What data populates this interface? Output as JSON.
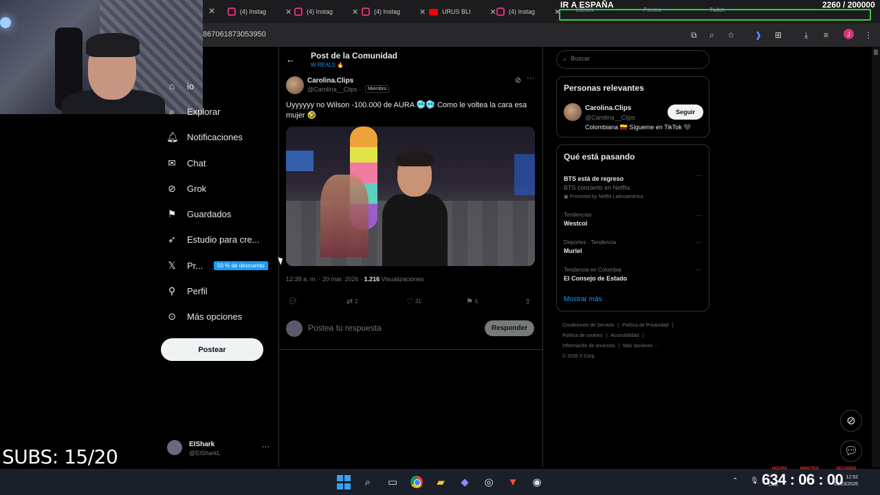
{
  "stream_overlay": {
    "goal_title": "IR A ESPAÑA",
    "goal_count": "2260 / 200000",
    "subs": "SUBS: 15/20",
    "timer": "634 : 06 : 00",
    "timer_labels": [
      "HOURS",
      "MINUTES",
      "SECONDS"
    ]
  },
  "browser": {
    "tabs": [
      {
        "label": "(4) Instag",
        "icon": "instagram-icon"
      },
      {
        "label": "(4) Instag",
        "icon": "instagram-icon"
      },
      {
        "label": "(4) Instag",
        "icon": "instagram-icon"
      },
      {
        "label": "URUS BLI",
        "icon": "youtube-icon"
      },
      {
        "label": "(4) Instag",
        "icon": "instagram-icon"
      }
    ],
    "group_tabs": [
      "ElDomi -",
      "Pereira",
      "Twitch"
    ],
    "url": "867061873053950",
    "profile_initial": "J"
  },
  "nav": {
    "items": [
      {
        "label": "io",
        "icon": "home-icon"
      },
      {
        "label": "Explorar",
        "icon": "search-icon"
      },
      {
        "label": "Notificaciones",
        "icon": "bell-icon"
      },
      {
        "label": "Chat",
        "icon": "mail-icon"
      },
      {
        "label": "Grok",
        "icon": "grok-icon"
      },
      {
        "label": "Guardados",
        "icon": "bookmark-icon"
      },
      {
        "label": "Estudio para cre...",
        "icon": "rocket-icon"
      },
      {
        "label": "Pr...",
        "icon": "x-logo-icon"
      },
      {
        "label": "Perfil",
        "icon": "person-icon"
      },
      {
        "label": "Más opciones",
        "icon": "more-circle-icon"
      }
    ],
    "premium_badge": "50 % de descuento",
    "post_button": "Postear",
    "account": {
      "name": "ElShark",
      "handle": "@ElSharkL"
    }
  },
  "post": {
    "header_title": "Post de la Comunidad",
    "header_sub": "W REALS 🔥",
    "author_name": "Carolina.Clips",
    "author_handle": "@Carolina__Clips ·",
    "member_badge": "Miembro",
    "text": "Uyyyyyy no Wilson -100.000 de AURA 🥶🥶 Como le voltea la cara esa mujer 🤣",
    "timestamp": "12:38 a. m. · 20 mar. 2026 ·",
    "views_count": "1.216",
    "views_label": "Visualizaciones",
    "actions": {
      "replies": "",
      "reposts": "2",
      "likes": "31",
      "bookmarks": "5"
    },
    "reply_placeholder": "Postea tu respuesta",
    "reply_button": "Responder"
  },
  "sidebar": {
    "search_placeholder": "Buscar",
    "relevant_title": "Personas relevantes",
    "relevant_person": {
      "name": "Carolina.Clips",
      "handle": "@Carolina__Clips",
      "bio": "Colombiana 🇨🇴 Sígueme en TikTok 🖤",
      "follow": "Seguir"
    },
    "trending_title": "Qué está pasando",
    "trends": [
      {
        "context": "",
        "title": "BTS está de regreso",
        "sub": "BTS concierto en Netflix",
        "promo": "Promoted by Netflix Latinoamérica"
      },
      {
        "context": "Tendencias",
        "title": "Westcol",
        "sub": "",
        "promo": ""
      },
      {
        "context": "Deportes · Tendencia",
        "title": "Muriel",
        "sub": "",
        "promo": ""
      },
      {
        "context": "Tendencia en Colombia",
        "title": "El Consejo de Estado",
        "sub": "",
        "promo": ""
      }
    ],
    "show_more": "Mostrar más",
    "footer": [
      "Condiciones de Servicio",
      "|",
      "Política de Privacidad",
      "|",
      "Política de cookies",
      "|",
      "Accesibilidad",
      "|",
      "Información de anuncios",
      "|",
      "Más opciones ···",
      "© 2026 X Corp."
    ]
  },
  "taskbar": {
    "clock_time": "12:52",
    "clock_date": "20/03/2026",
    "lang": "LAA"
  }
}
